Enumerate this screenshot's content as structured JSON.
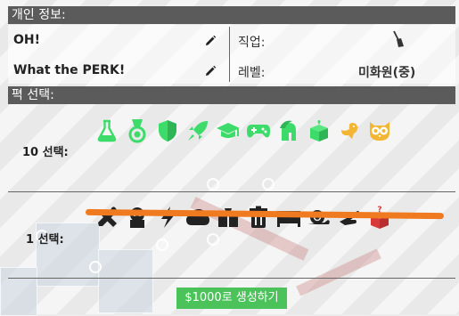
{
  "personal_info": {
    "header": "개인 정보:",
    "name": "OH!",
    "tagline": "What the PERK!",
    "job_label": "직업:",
    "job_icon": "broom-icon",
    "level_label": "레벨:",
    "level_value": "미화원(중)"
  },
  "perk_select": {
    "header": "펵 선택:",
    "group_10_label": "10 선택:",
    "group_10_icons": [
      "flask-icon",
      "medal-icon",
      "shield-icon",
      "rocket-icon",
      "graduation-cap-icon",
      "gamepad-icon",
      "spartan-helmet-icon",
      "gift-box-icon",
      "bird-icon",
      "owl-icon"
    ],
    "group_1_label": "1 선택:",
    "group_1_icons": [
      "tools-icon",
      "robot-icon",
      "lightning-icon",
      "cloud-icon",
      "suit-icon",
      "trash-can-icon",
      "bed-icon",
      "snail-icon",
      "hand-icon",
      "mystery-box-icon"
    ]
  },
  "generate_button": "$1000로 생성하기",
  "colors": {
    "header_bg": "#5b5b5b",
    "perk_good": "#3ddc6a",
    "perk_yellow": "#f2b632",
    "perk_bad": "#222222",
    "mystery_red": "#d83a3a",
    "strike_orange": "#f07a20",
    "button_green": "#4cc35a"
  }
}
